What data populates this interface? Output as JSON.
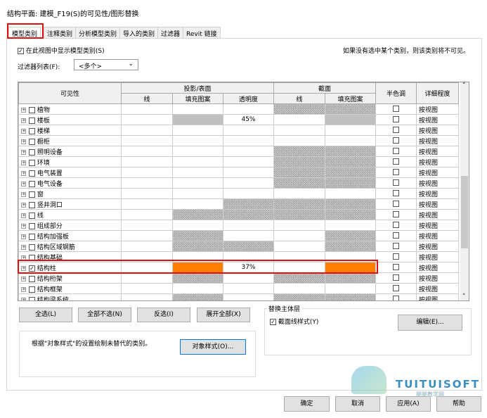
{
  "window": {
    "title": "结构平面: 建模_F19(S)的可见性/图形替换"
  },
  "tabs": [
    "模型类别",
    "注释类别",
    "分析模型类别",
    "导入的类别",
    "过滤器",
    "Revit 链接"
  ],
  "show_categories": {
    "label": "在此视图中显示模型类别(S)",
    "checked": true
  },
  "hint": "如果没有选中某个类别，则该类别将不可见。",
  "filter_list": {
    "label": "过滤器列表(F):",
    "value": "<多个>"
  },
  "table": {
    "headers": {
      "visibility": "可见性",
      "projection": "投影/表面",
      "cut": "截面",
      "halftone": "半色调",
      "detail": "详细程度",
      "line": "线",
      "fill": "填充图案",
      "transparency": "透明度"
    },
    "rows": [
      {
        "name": "植物",
        "checked": false,
        "cells": [
          "w",
          "w",
          "w",
          "h",
          "h"
        ],
        "transp": "",
        "detail": "按视图"
      },
      {
        "name": "楼板",
        "checked": false,
        "cells": [
          "w",
          "g",
          "w",
          "w",
          "g"
        ],
        "transp": "45%",
        "detail": "按视图"
      },
      {
        "name": "楼梯",
        "checked": false,
        "cells": [
          "w",
          "w",
          "w",
          "w",
          "w"
        ],
        "transp": "",
        "detail": "按视图"
      },
      {
        "name": "橱柜",
        "checked": false,
        "cells": [
          "w",
          "w",
          "w",
          "w",
          "w"
        ],
        "transp": "",
        "detail": "按视图"
      },
      {
        "name": "照明设备",
        "checked": false,
        "cells": [
          "w",
          "w",
          "w",
          "h",
          "h"
        ],
        "transp": "",
        "detail": "按视图"
      },
      {
        "name": "环境",
        "checked": false,
        "cells": [
          "w",
          "w",
          "w",
          "h",
          "h"
        ],
        "transp": "",
        "detail": "按视图"
      },
      {
        "name": "电气装置",
        "checked": false,
        "cells": [
          "w",
          "w",
          "w",
          "h",
          "h"
        ],
        "transp": "",
        "detail": "按视图"
      },
      {
        "name": "电气设备",
        "checked": false,
        "cells": [
          "w",
          "w",
          "w",
          "h",
          "h"
        ],
        "transp": "",
        "detail": "按视图"
      },
      {
        "name": "窗",
        "checked": false,
        "cells": [
          "w",
          "w",
          "w",
          "w",
          "w"
        ],
        "transp": "",
        "detail": "按视图"
      },
      {
        "name": "竖井洞口",
        "checked": false,
        "cells": [
          "w",
          "w",
          "h",
          "h",
          "h"
        ],
        "transp": "",
        "detail": "按视图"
      },
      {
        "name": "线",
        "checked": false,
        "cells": [
          "w",
          "h",
          "h",
          "h",
          "h"
        ],
        "transp": "",
        "detail": "按视图"
      },
      {
        "name": "组成部分",
        "checked": false,
        "cells": [
          "w",
          "w",
          "w",
          "w",
          "w"
        ],
        "transp": "",
        "detail": "按视图"
      },
      {
        "name": "结构加强板",
        "checked": false,
        "cells": [
          "w",
          "h",
          "w",
          "w",
          "h"
        ],
        "transp": "",
        "detail": "按视图"
      },
      {
        "name": "结构区域钢筋",
        "checked": false,
        "cells": [
          "w",
          "h",
          "h",
          "w",
          "h"
        ],
        "transp": "",
        "detail": "按视图"
      },
      {
        "name": "结构基础",
        "checked": false,
        "cells": [
          "w",
          "w",
          "w",
          "w",
          "w"
        ],
        "transp": "",
        "detail": "按视图"
      },
      {
        "name": "结构柱",
        "checked": true,
        "cells": [
          "w",
          "o",
          "w",
          "w",
          "o"
        ],
        "transp": "37%",
        "detail": "按视图"
      },
      {
        "name": "结构桁架",
        "checked": false,
        "cells": [
          "w",
          "h",
          "w",
          "h",
          "h"
        ],
        "transp": "",
        "detail": "按视图"
      },
      {
        "name": "结构框架",
        "checked": false,
        "cells": [
          "w",
          "w",
          "w",
          "w",
          "w"
        ],
        "transp": "",
        "detail": "按视图"
      },
      {
        "name": "结构梁系统",
        "checked": false,
        "cells": [
          "w",
          "h",
          "w",
          "h",
          "h"
        ],
        "transp": "",
        "detail": "按视图"
      }
    ]
  },
  "buttons": {
    "select_all": "全选(L)",
    "select_none": "全部不选(N)",
    "invert": "反选(I)",
    "expand_all": "展开全部(X)",
    "object_styles": "对象样式(O)...",
    "edit": "编辑(E)...",
    "ok": "确定",
    "cancel": "取消",
    "apply": "应用(A)",
    "help": "帮助"
  },
  "object_styles_note": "根据\"对象样式\"的设置绘制未替代的类别。",
  "host_layer": {
    "title": "替换主体层",
    "cut_line_styles": "截面线样式(Y)",
    "checked": true
  },
  "watermark": {
    "brand": "TUITUISOFT",
    "sub": "腿腿教学网"
  },
  "colors": {
    "override": "#ff8000",
    "highlight": "#e01010"
  }
}
